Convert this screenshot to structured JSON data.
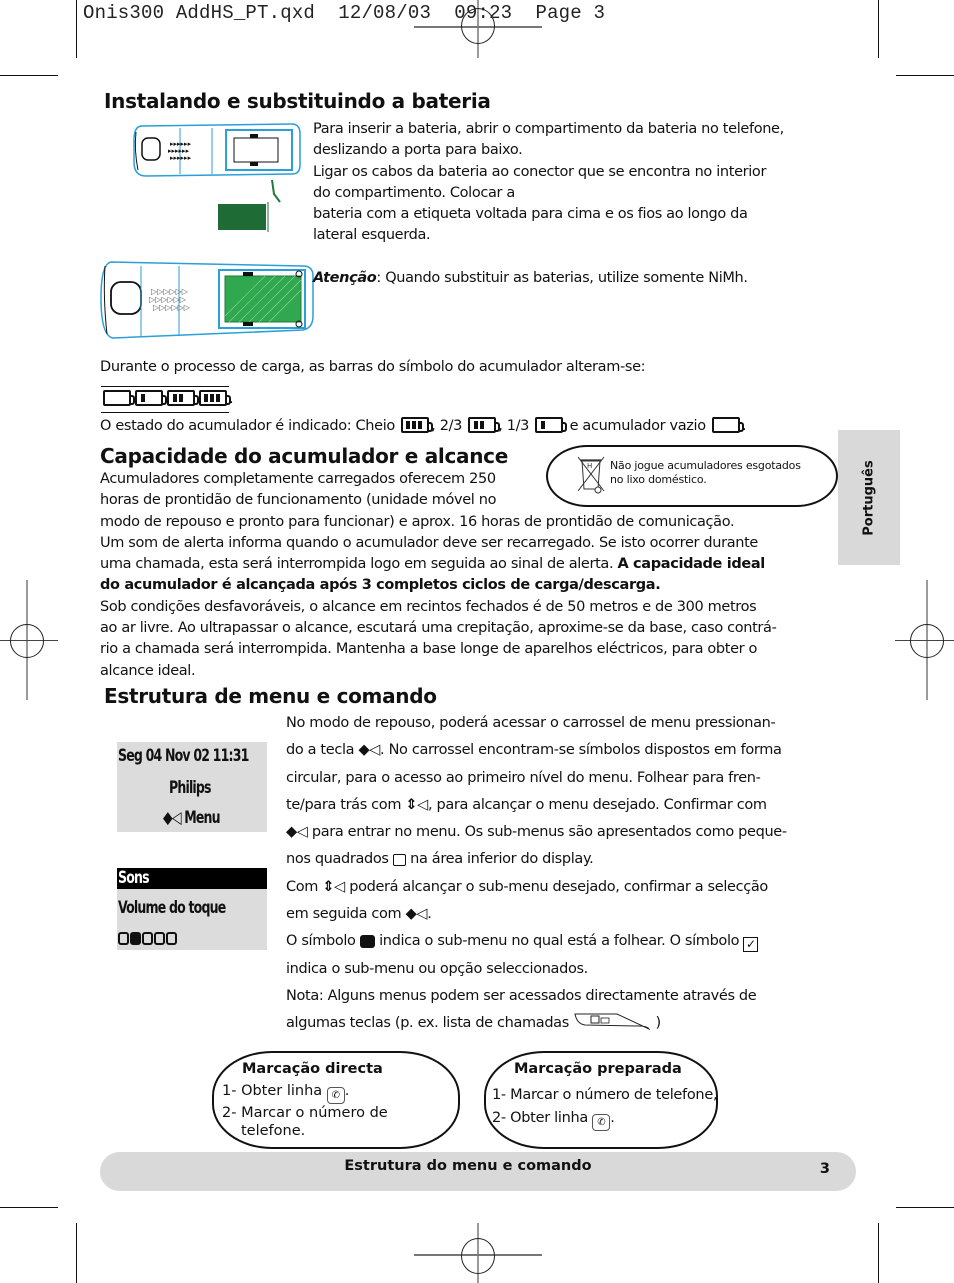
{
  "slug": "Onis300 AddHS_PT.qxd  12/08/03  09:23  Page 3",
  "side_tab": "Português",
  "section1": {
    "title": "Instalando e substituindo a bateria",
    "para_lines": [
      "Para inserir a bateria, abrir o compartimento da bateria no telefone,",
      "deslizando a porta para baixo.",
      "Ligar os cabos da bateria ao conector que se encontra no interior",
      "do compartimento. Colocar a",
      "bateria com a etiqueta voltada para cima e os fios ao longo da",
      "lateral esquerda."
    ],
    "attention_label": "Atenção",
    "attention_text": ": Quando substituir as baterias, utilize somente NiMh.",
    "charge_text": "Durante o processo de carga, as barras do símbolo do acumulador alteram-se:",
    "charge_sequence_bars": [
      0,
      1,
      2,
      3
    ],
    "charge_period": ".",
    "status_intro": "O estado do acumulador é indicado: Cheio",
    "status_items": [
      {
        "label": ", 2/3",
        "bars": 2
      },
      {
        "label": ", 1/3",
        "bars": 1
      },
      {
        "label": " e acumulador vazio",
        "bars": 0
      }
    ],
    "status_full_bars": 3,
    "status_end": "."
  },
  "section2": {
    "title": "Capacidade do acumulador e alcance",
    "notice": {
      "line1": "Não jogue acumuladores esgotados",
      "line2": "no lixo doméstico.",
      "icon": "crossed-bin-icon"
    },
    "narrow_lines": [
      "Acumuladores completamente carregados oferecem 250",
      "horas de prontidão de funcionamento (unidade móvel no"
    ],
    "full_lines": [
      "modo de repouso e pronto para funcionar) e aprox. 16 horas de prontidão de comunicação.",
      "Um som de alerta informa quando o acumulador deve ser recarregado. Se isto ocorrer durante",
      "uma chamada, esta será interrompida logo em seguida ao sinal de alerta. "
    ],
    "bold_line_a": "A capacidade ideal",
    "bold_line_b": "do acumulador é alcançada após 3 completos ciclos de carga/descarga.",
    "range_lines": [
      "Sob condições desfavoráveis, o alcance em recintos fechados é de 50 metros e de 300 metros",
      "ao ar livre. Ao ultrapassar o alcance, escutará uma crepitação, aproxime-se da base, caso contrá-",
      "rio a chamada será interrompida. Mantenha a base longe de aparelhos eléctricos, para obter o",
      "alcance ideal."
    ]
  },
  "section3": {
    "title": "Estrutura de menu e comando",
    "lcd1": {
      "line1": "Seg 04 Nov 02   11:31",
      "line2": "Philips",
      "line3": "Menu"
    },
    "lcd2": {
      "header": "Sons",
      "line2": "Volume do toque",
      "level": 2,
      "level_max": 5
    },
    "t1": "No modo de repouso, poderá acessar o carrossel de menu pressionan-",
    "t2a": "do a tecla ",
    "t2b": ". No carrossel encontram-se símbolos dispostos em forma",
    "t3": "circular, para o acesso ao primeiro nível do menu. Folhear para fren-",
    "t4a": "te/para trás com ",
    "t4b": ", para alcançar o menu desejado. Confirmar com",
    "t5b": " para entrar no menu. Os sub-menus são apresentados como peque-",
    "t6a": "nos quadrados ",
    "t6b": " na área inferior do display.",
    "t7a": "Com ",
    "t7b": " poderá alcançar o sub-menu desejado, confirmar a selecção",
    "t8a": "em seguida com ",
    "t8b": ".",
    "t9a": "O símbolo ",
    "t9b": " indica o sub-menu no qual está a folhear. O símbolo ",
    "t10": "indica o sub-menu ou opção seleccionados.",
    "t11": "Nota: Alguns menus podem ser acessados directamente através de",
    "t12a": "algumas teclas (p. ex. lista de chamadas ",
    "t12b": ")"
  },
  "box_direct": {
    "title": "Marcação directa",
    "item1": "1- Obter linha ",
    "item1_end": ".",
    "item2a": "2- Marcar o número de",
    "item2b": "telefone."
  },
  "box_prepared": {
    "title": "Marcação preparada",
    "item1": "1- Marcar o número de telefone,",
    "item2": "2- Obter linha ",
    "item2_end": "."
  },
  "footer": {
    "title": "Estrutura do menu e comando",
    "page_number": "3"
  }
}
